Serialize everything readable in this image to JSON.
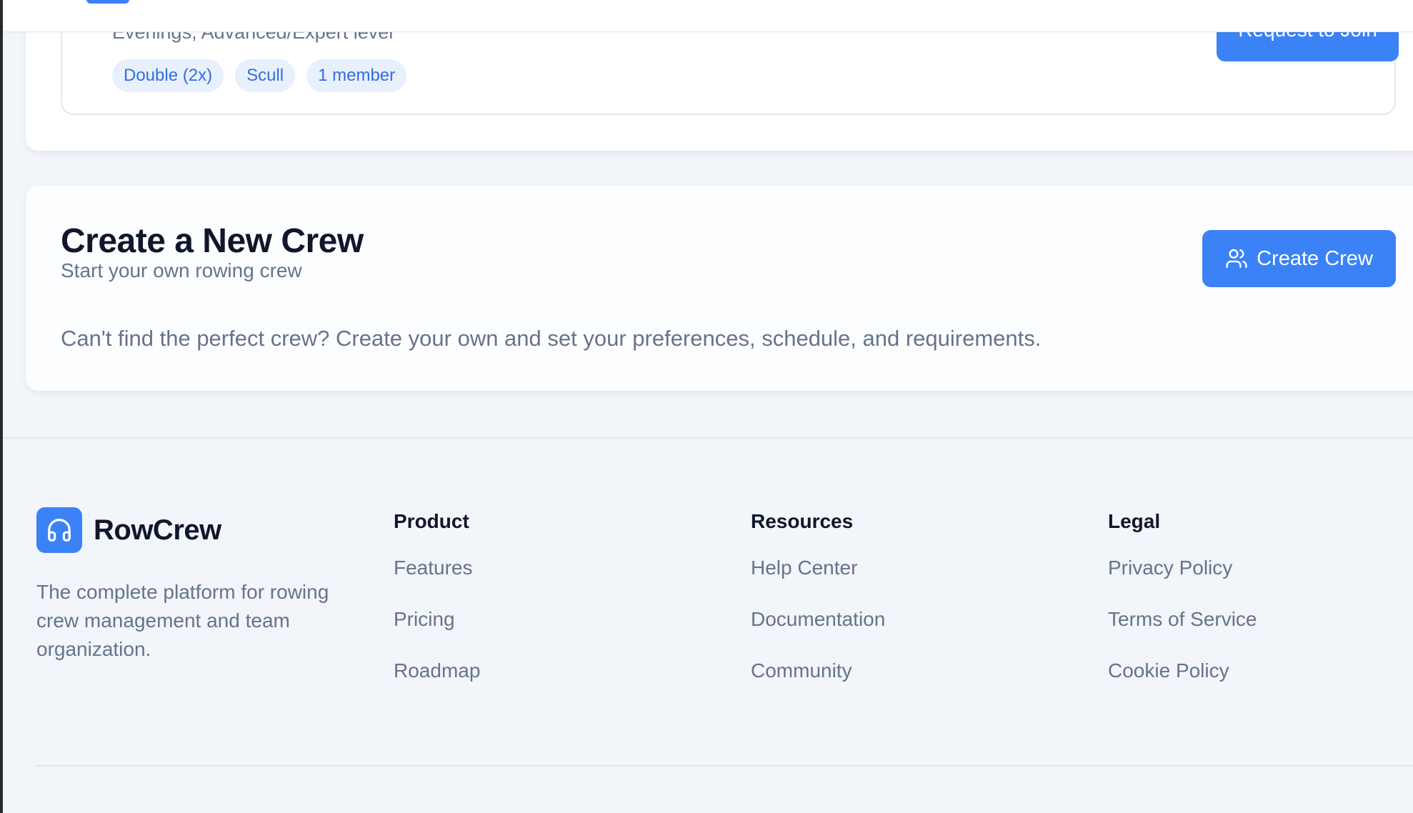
{
  "crew_card": {
    "meta": "Evenings, Advanced/Expert level",
    "tags": [
      "Double (2x)",
      "Scull",
      "1 member"
    ],
    "join_label": "Request to Join"
  },
  "create": {
    "title": "Create a New Crew",
    "subtitle": "Start your own rowing crew",
    "button_label": "Create Crew",
    "button_icon": "users-icon",
    "description": "Can't find the perfect crew? Create your own and set your preferences, schedule, and requirements."
  },
  "footer": {
    "brand": {
      "name": "RowCrew",
      "icon": "headphones-icon",
      "description": "The complete platform for rowing crew management and team organization."
    },
    "columns": [
      {
        "title": "Product",
        "links": [
          "Features",
          "Pricing",
          "Roadmap"
        ]
      },
      {
        "title": "Resources",
        "links": [
          "Help Center",
          "Documentation",
          "Community"
        ]
      },
      {
        "title": "Legal",
        "links": [
          "Privacy Policy",
          "Terms of Service",
          "Cookie Policy"
        ]
      }
    ]
  },
  "colors": {
    "accent": "#3b82f6",
    "tag_bg": "#e8f0fe",
    "tag_text": "#2f6fe0",
    "heading": "#0f172a",
    "muted": "#64748b",
    "footer_bg": "#f2f5f9"
  }
}
